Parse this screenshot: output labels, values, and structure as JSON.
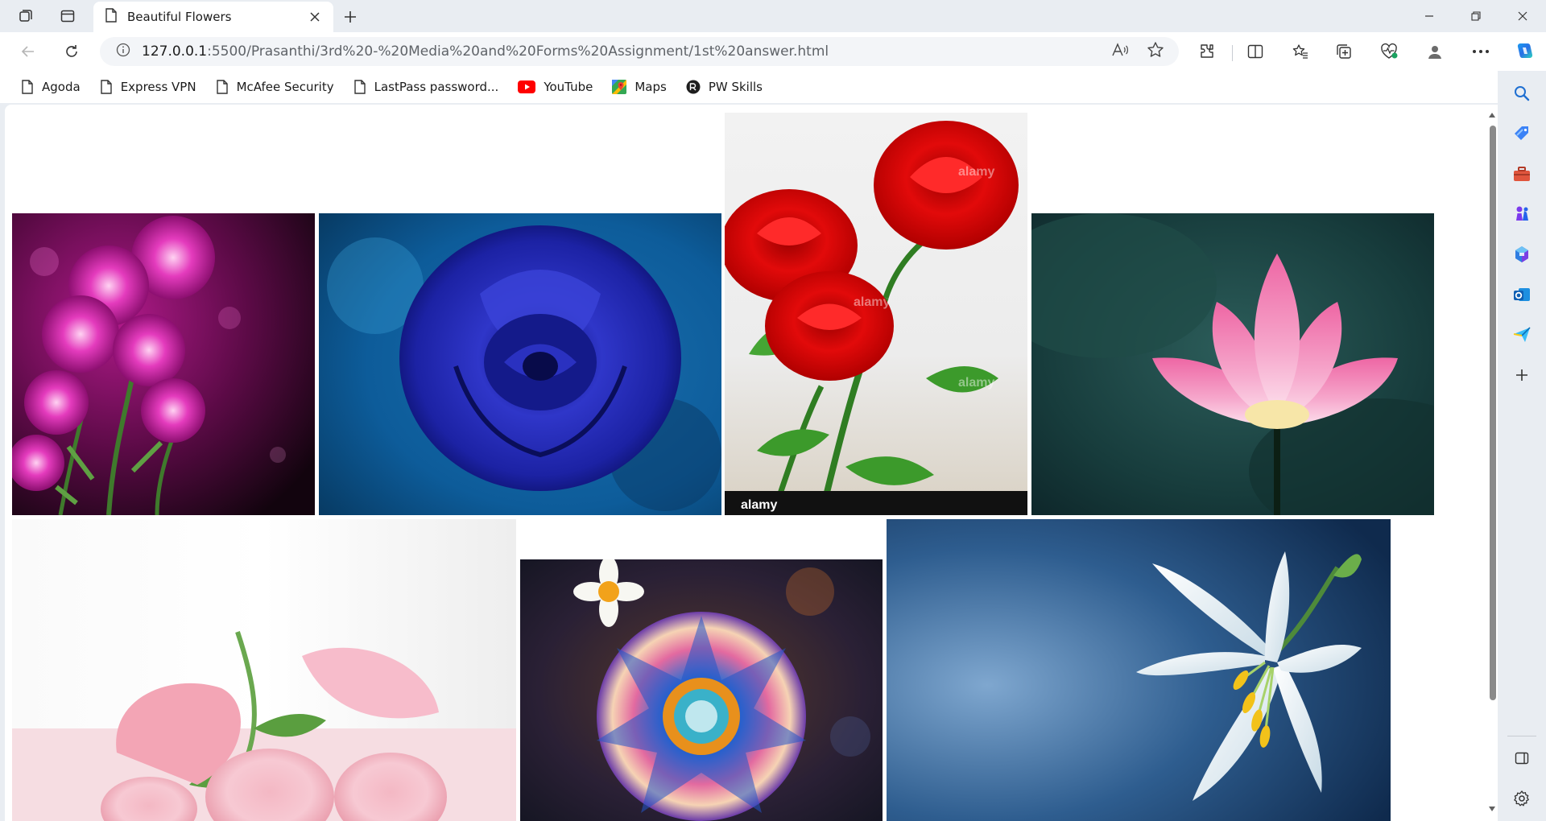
{
  "tab": {
    "title": "Beautiful Flowers"
  },
  "address": {
    "host": "127.0.0.1",
    "path": ":5500/Prasanthi/3rd%20-%20Media%20and%20Forms%20Assignment/1st%20answer.html"
  },
  "bookmarks": [
    {
      "label": "Agoda",
      "icon": "page-icon"
    },
    {
      "label": "Express VPN",
      "icon": "page-icon"
    },
    {
      "label": "McAfee Security",
      "icon": "page-icon"
    },
    {
      "label": "LastPass password...",
      "icon": "page-icon"
    },
    {
      "label": "YouTube",
      "icon": "youtube-icon"
    },
    {
      "label": "Maps",
      "icon": "maps-icon"
    },
    {
      "label": "PW Skills",
      "icon": "pw-skills-icon"
    }
  ],
  "images": [
    {
      "name": "pink-aster-flowers-image",
      "subject": "pink aster flowers",
      "watermark": ""
    },
    {
      "name": "blue-rose-image",
      "subject": "blue rose",
      "watermark": ""
    },
    {
      "name": "red-roses-image",
      "subject": "red roses",
      "watermark": "alamy"
    },
    {
      "name": "pink-lotus-image",
      "subject": "pink lotus",
      "watermark": ""
    },
    {
      "name": "pink-roses-image",
      "subject": "pink roses",
      "watermark": ""
    },
    {
      "name": "colorful-flower-image",
      "subject": "colorful flower",
      "watermark": ""
    },
    {
      "name": "white-lily-image",
      "subject": "white lily",
      "watermark": ""
    }
  ],
  "colors": {
    "chrome": "#e9edf2",
    "accent": "#0f6cbd",
    "youtube": "#ff0000"
  }
}
